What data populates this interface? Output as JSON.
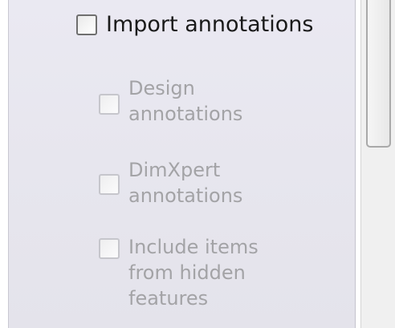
{
  "options": {
    "import_annotations": {
      "label": "Import annotations",
      "checked": false,
      "enabled": true
    },
    "design_annotations": {
      "label_line1": "Design",
      "label_line2": "annotations",
      "checked": false,
      "enabled": false
    },
    "dimxpert_annotations": {
      "label_line1": "DimXpert",
      "label_line2": "annotations",
      "checked": false,
      "enabled": false
    },
    "hidden_features": {
      "label_line1": "Include items",
      "label_line2": "from hidden",
      "label_line3": "features",
      "checked": false,
      "enabled": false
    }
  },
  "colors": {
    "panel_background": "#e8e7ef",
    "enabled_text": "#1a1a1a",
    "disabled_text": "#a3a3a6"
  }
}
